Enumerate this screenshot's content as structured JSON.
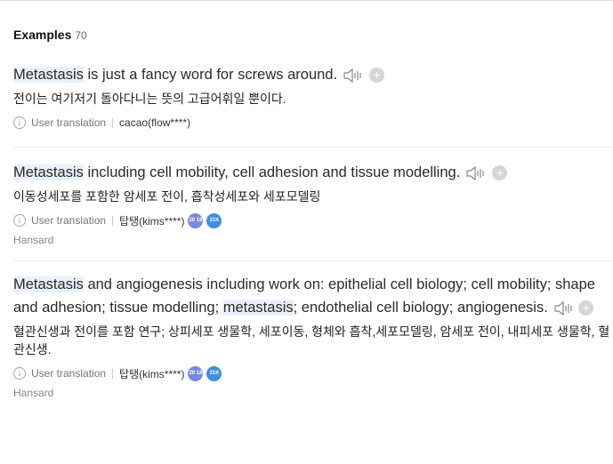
{
  "section": {
    "title": "Examples",
    "count": "70"
  },
  "labels": {
    "user_translation": "User translation"
  },
  "examples": [
    {
      "en": [
        {
          "text": "Metastasis",
          "hl": true
        },
        {
          "text": " is just a fancy word for screws around.",
          "hl": false
        }
      ],
      "ko": "전이는 여기저기 돌아다니는 뜻의 고급어휘일 뿐이다.",
      "user": "cacao(flow****)",
      "badges": [],
      "source": ""
    },
    {
      "en": [
        {
          "text": "Metastasis",
          "hl": true
        },
        {
          "text": " including cell mobility, cell adhesion and tissue modelling.",
          "hl": false
        }
      ],
      "ko": "이동성세포를 포함한 암세포 전이, 흡착성세포와 세포모델링",
      "user": "탑탱(kims****)",
      "badges": [
        "20 18",
        "31K"
      ],
      "source": "Hansard"
    },
    {
      "en": [
        {
          "text": "Metastasis",
          "hl": true
        },
        {
          "text": " and angiogenesis including work on: epithelial cell biology; cell mobility; shape and adhesion; tissue modelling; ",
          "hl": false
        },
        {
          "text": "metastasis",
          "hl": true
        },
        {
          "text": "; endothelial cell biology; angiogenesis.",
          "hl": false
        }
      ],
      "ko": "혈관신생과 전이를 포함 연구; 상피세포 생물학, 세포이동, 형체와 흡착,세포모델링, 암세포 전이, 내피세포 생물학, 혈관신생.",
      "user": "탑탱(kims****)",
      "badges": [
        "20 18",
        "31K"
      ],
      "source": "Hansard"
    }
  ],
  "colors": {
    "highlight": "#e8f1fb",
    "badge_purple": "#7a88d8",
    "badge_blue": "#3d8de0",
    "plus_gray": "#d6d6d6"
  }
}
